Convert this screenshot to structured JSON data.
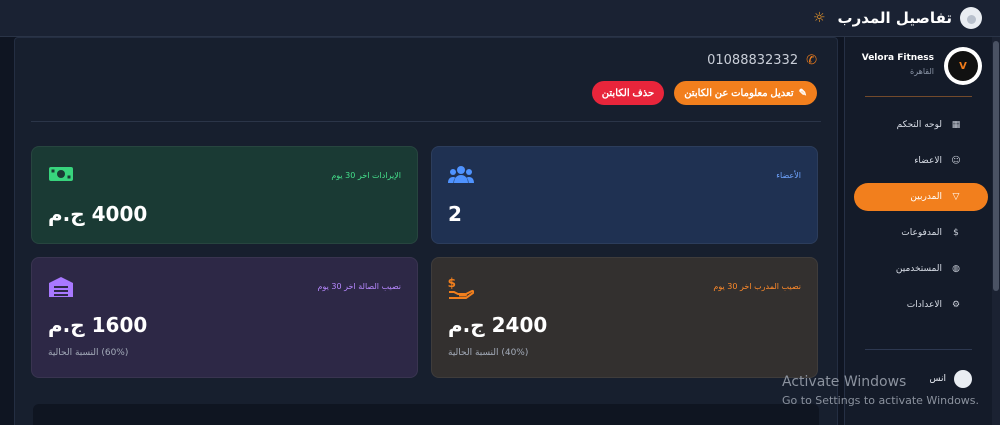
{
  "header": {
    "title": "تفاصيل المدرب",
    "theme_icon": "sun-icon"
  },
  "trainer": {
    "phone": "01088832332",
    "edit_label": "تعديل معلومات عن الكابتن",
    "delete_label": "حذف الكابتن"
  },
  "stats": {
    "members": {
      "label": "الأعضاء",
      "value": "2",
      "icon": "users-icon",
      "color": "#4f93ff"
    },
    "revenue": {
      "label": "الإيرادات اخر 30 يوم",
      "value": "4000 ج.م",
      "icon": "money-icon",
      "color": "#38d47d"
    },
    "trainer_share": {
      "label": "نصيب المدرب اخر 30 يوم",
      "value": "2400 ج.م",
      "sub": "(40%) النسبة الحالية",
      "icon": "hand-dollar-icon",
      "color": "#f27f1d"
    },
    "gym_share": {
      "label": "نصيب الصالة اخر 30 يوم",
      "value": "1600 ج.م",
      "sub": "(60%) النسبة الحالية",
      "icon": "warehouse-icon",
      "color": "#a878ff"
    }
  },
  "sidebar": {
    "brand_name": "Velora Fitness",
    "brand_city": "القاهرة",
    "logo_text": "VELORA",
    "items": [
      {
        "label": "لوحه التحكم",
        "icon": "dashboard-icon",
        "active": false
      },
      {
        "label": "الاعضاء",
        "icon": "user-icon",
        "active": false
      },
      {
        "label": "المدربين",
        "icon": "trophy-icon",
        "active": true
      },
      {
        "label": "المدفوعات",
        "icon": "money-bag-icon",
        "active": false
      },
      {
        "label": "المستخدمين",
        "icon": "user-shield-icon",
        "active": false
      },
      {
        "label": "الاعدادات",
        "icon": "gear-icon",
        "active": false
      }
    ],
    "user_name": "انس"
  },
  "watermark": {
    "line1": "Activate Windows",
    "line2": "Go to Settings to activate Windows."
  },
  "colors": {
    "accent": "#f27f1d",
    "danger": "#e8253b"
  }
}
